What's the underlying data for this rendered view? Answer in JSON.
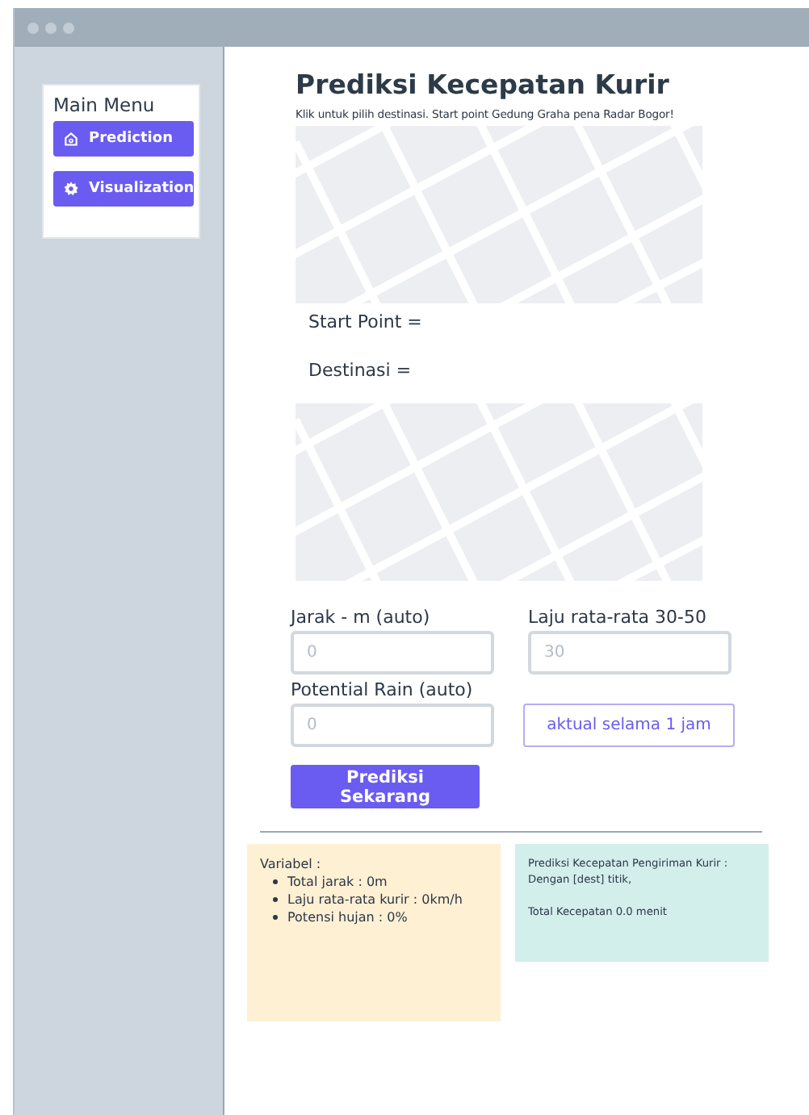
{
  "sidebar": {
    "title": "Main Menu",
    "items": [
      {
        "label": "Prediction",
        "kind": "home"
      },
      {
        "label": "Visualization",
        "kind": "gear"
      }
    ]
  },
  "main": {
    "title": "Prediksi Kecepatan Kurir",
    "subtitle": "Klik untuk pilih destinasi. Start point Gedung Graha pena Radar Bogor!",
    "start_label": "Start Point =",
    "dest_label": "Destinasi =",
    "fields": [
      {
        "label": "Jarak - m (auto)",
        "placeholder": "0"
      },
      {
        "label": "Laju rata-rata 30-50",
        "placeholder": "30"
      },
      {
        "label": "Potential Rain (auto)",
        "placeholder": "0"
      }
    ],
    "info_button": "aktual selama 1 jam",
    "submit_button": "Prediksi Sekarang"
  },
  "variables": {
    "title": "Variabel :",
    "items": [
      "Total jarak : 0m",
      "Laju rata-rata kurir : 0km/h",
      "Potensi hujan : 0%"
    ]
  },
  "result": {
    "lines": [
      "Prediksi Kecepatan Pengiriman Kurir :",
      "Dengan [dest] titik,"
    ],
    "total": "Total Kecepatan 0.0 menit"
  }
}
